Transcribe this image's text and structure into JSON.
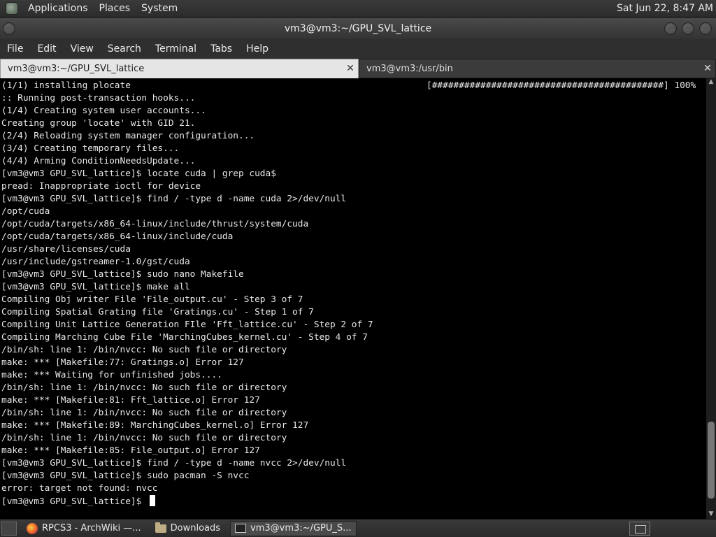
{
  "top_panel": {
    "menus": [
      "Applications",
      "Places",
      "System"
    ],
    "clock": "Sat Jun 22,  8:47 AM"
  },
  "window": {
    "title": "vm3@vm3:~/GPU_SVL_lattice"
  },
  "menubar": [
    "File",
    "Edit",
    "View",
    "Search",
    "Terminal",
    "Tabs",
    "Help"
  ],
  "tabs": [
    {
      "label": "vm3@vm3:~/GPU_SVL_lattice",
      "active": true,
      "close": "✕"
    },
    {
      "label": "vm3@vm3:/usr/bin",
      "active": false,
      "close": "✕"
    }
  ],
  "terminal": {
    "progress": "[###########################################] 100%",
    "lines": [
      "(1/1) installing plocate",
      ":: Running post-transaction hooks...",
      "(1/4) Creating system user accounts...",
      "Creating group 'locate' with GID 21.",
      "(2/4) Reloading system manager configuration...",
      "(3/4) Creating temporary files...",
      "(4/4) Arming ConditionNeedsUpdate...",
      "[vm3@vm3 GPU_SVL_lattice]$ locate cuda | grep cuda$",
      "pread: Inappropriate ioctl for device",
      "[vm3@vm3 GPU_SVL_lattice]$ find / -type d -name cuda 2>/dev/null",
      "/opt/cuda",
      "/opt/cuda/targets/x86_64-linux/include/thrust/system/cuda",
      "/opt/cuda/targets/x86_64-linux/include/cuda",
      "/usr/share/licenses/cuda",
      "/usr/include/gstreamer-1.0/gst/cuda",
      "[vm3@vm3 GPU_SVL_lattice]$ sudo nano Makefile",
      "[vm3@vm3 GPU_SVL_lattice]$ make all",
      "Compiling Obj writer File 'File_output.cu' - Step 3 of 7",
      "Compiling Spatial Grating file 'Gratings.cu' - Step 1 of 7",
      "Compiling Unit Lattice Generation FIle 'Fft_lattice.cu' - Step 2 of 7",
      "Compiling Marching Cube File 'MarchingCubes_kernel.cu' - Step 4 of 7",
      "/bin/sh: line 1: /bin/nvcc: No such file or directory",
      "make: *** [Makefile:77: Gratings.o] Error 127",
      "make: *** Waiting for unfinished jobs....",
      "/bin/sh: line 1: /bin/nvcc: No such file or directory",
      "make: *** [Makefile:81: Fft_lattice.o] Error 127",
      "/bin/sh: line 1: /bin/nvcc: No such file or directory",
      "make: *** [Makefile:89: MarchingCubes_kernel.o] Error 127",
      "/bin/sh: line 1: /bin/nvcc: No such file or directory",
      "make: *** [Makefile:85: File_output.o] Error 127",
      "[vm3@vm3 GPU_SVL_lattice]$ find / -type d -name nvcc 2>/dev/null",
      "[vm3@vm3 GPU_SVL_lattice]$ sudo pacman -S nvcc",
      "error: target not found: nvcc",
      "[vm3@vm3 GPU_SVL_lattice]$ "
    ]
  },
  "taskbar": {
    "items": [
      {
        "label": "RPCS3 - ArchWiki —...",
        "icon": "firefox-icon"
      },
      {
        "label": "Downloads",
        "icon": "folder-icon"
      },
      {
        "label": "vm3@vm3:~/GPU_S...",
        "icon": "terminal-icon",
        "active": true
      }
    ]
  },
  "scrollbar": {
    "position": 0.97
  }
}
